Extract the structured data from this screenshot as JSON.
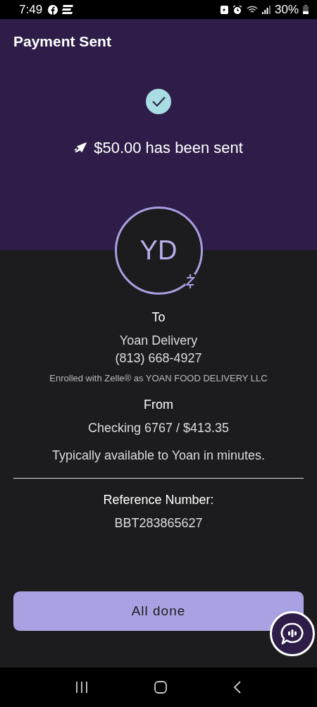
{
  "status_bar": {
    "time": "7:49",
    "battery": "30%"
  },
  "header": {
    "title": "Payment Sent",
    "message": "$50.00 has been sent"
  },
  "recipient": {
    "initials": "YD",
    "to_label": "To",
    "name": "Yoan Delivery",
    "phone": "(813) 668-4927",
    "enrollment": "Enrolled with Zelle® as YOAN FOOD DELIVERY LLC"
  },
  "source": {
    "from_label": "From",
    "account": "Checking 6767 / $413.35",
    "availability": "Typically available to Yoan in minutes."
  },
  "reference": {
    "label": "Reference Number:",
    "value": "BBT283865627"
  },
  "buttons": [
    "All done"
  ]
}
